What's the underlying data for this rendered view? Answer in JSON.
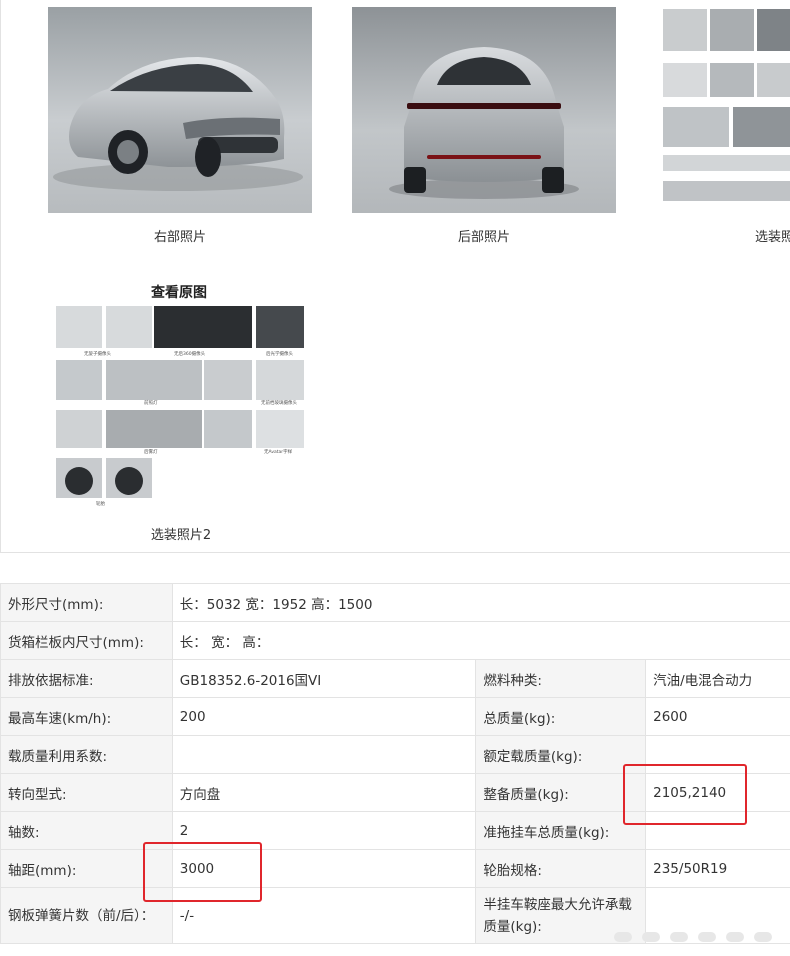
{
  "gallery": {
    "photos": [
      {
        "caption": "右部照片",
        "icon": "car-front-right-photo"
      },
      {
        "caption": "后部照片",
        "icon": "car-rear-photo"
      },
      {
        "caption": "选装照",
        "icon": "optional-parts-photo"
      }
    ],
    "view_original": "查看原图",
    "optional_photo_2": {
      "caption": "选装照片2",
      "icon": "optional-parts-collage"
    },
    "collage_labels": [
      "无旋子摄像头",
      "无后360摄像头",
      "后光学摄像头",
      "前照灯",
      "无前档玻璃摄像头",
      "后雾灯",
      "无Avatar字样",
      "轮胎"
    ]
  },
  "spec": {
    "rows": [
      {
        "k1": "外形尺寸(mm):",
        "v1": "长：5032 宽：1952 高：1500"
      },
      {
        "k1": "货箱栏板内尺寸(mm):",
        "v1": "长： 宽： 高："
      },
      {
        "k1": "排放依据标准:",
        "v1": "GB18352.6-2016国VI",
        "k2": "燃料种类:",
        "v2": "汽油/电混合动力"
      },
      {
        "k1": "最高车速(km/h):",
        "v1": "200",
        "k2": "总质量(kg):",
        "v2": "2600"
      },
      {
        "k1": "载质量利用系数:",
        "v1": "",
        "k2": "额定载质量(kg):",
        "v2": ""
      },
      {
        "k1": "转向型式:",
        "v1": "方向盘",
        "k2": "整备质量(kg):",
        "v2": "2105,2140"
      },
      {
        "k1": "轴数:",
        "v1": "2",
        "k2": "准拖挂车总质量(kg):",
        "v2": ""
      },
      {
        "k1": "轴距(mm):",
        "v1": "3000",
        "k2": "轮胎规格:",
        "v2": "235/50R19"
      },
      {
        "k1": "钢板弹簧片数（前/后）：",
        "v1": "-/-",
        "k2": "半挂车鞍座最大允许承载质量(kg):",
        "v2": ""
      }
    ]
  },
  "colors": {
    "highlight": "#e0262c",
    "key_bg": "#f5f5f5",
    "border": "#e3e3e3"
  }
}
